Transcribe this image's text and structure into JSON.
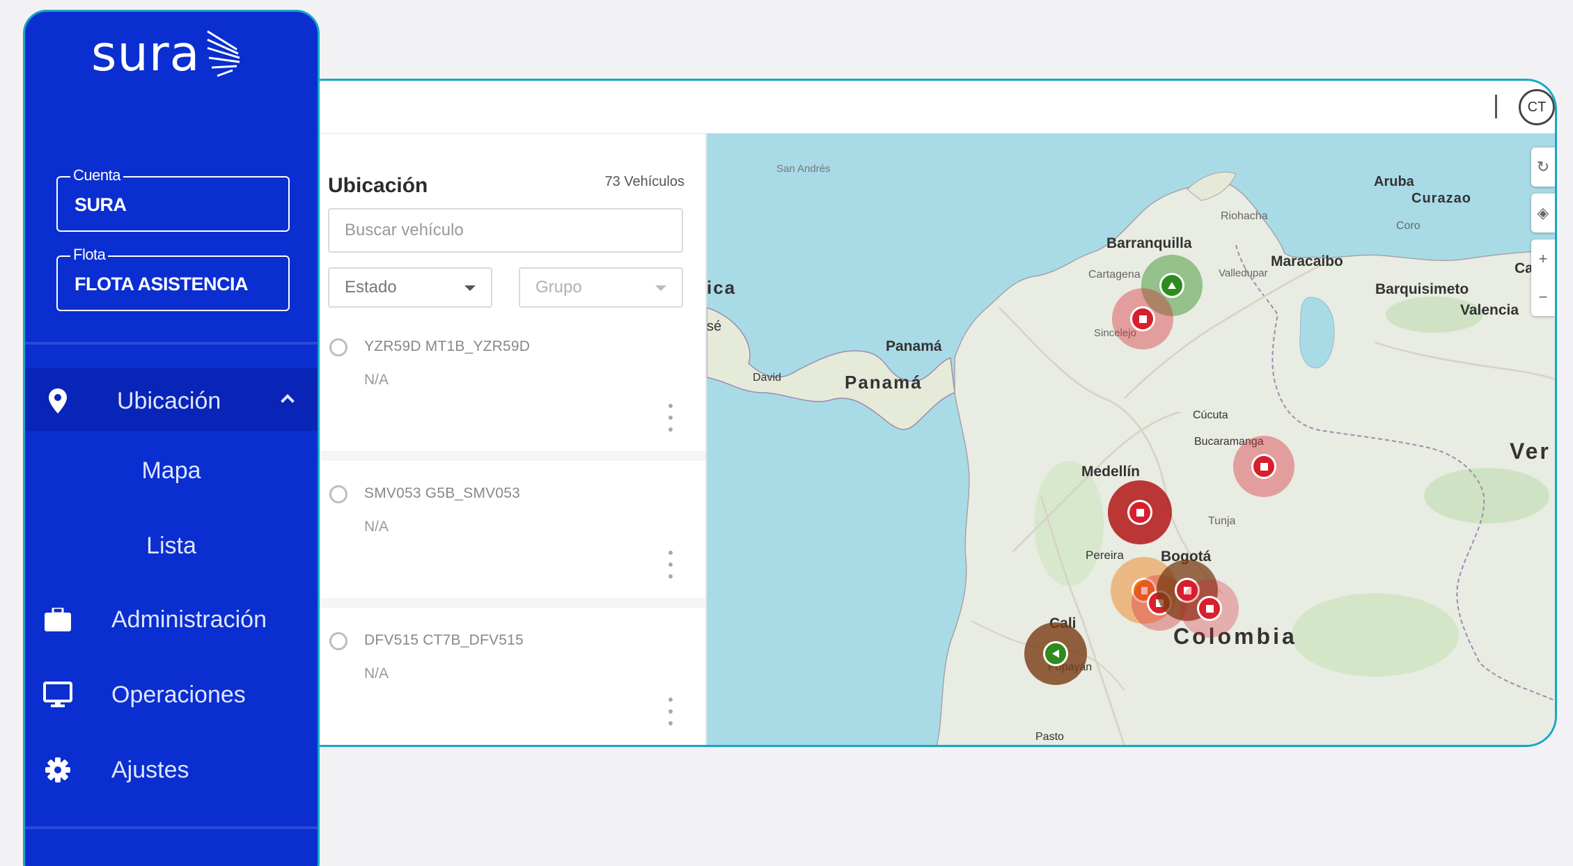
{
  "sidebar": {
    "brand": "sura",
    "account": {
      "legend": "Cuenta",
      "value": "SURA"
    },
    "fleet": {
      "legend": "Flota",
      "value": "FLOTA ASISTENCIA"
    },
    "nav": {
      "location": {
        "label": "Ubicación",
        "icon": "location-pin-icon"
      },
      "sub_map": "Mapa",
      "sub_list": "Lista",
      "admin": {
        "label": "Administración",
        "icon": "briefcase-icon"
      },
      "operations": {
        "label": "Operaciones",
        "icon": "monitor-icon"
      },
      "settings": {
        "label": "Ajustes",
        "icon": "gear-icon"
      }
    }
  },
  "topbar": {
    "avatar_initials": "CT"
  },
  "panel": {
    "title": "Ubicación",
    "count": "73 Vehículos",
    "search_placeholder": "Buscar vehículo",
    "filter_status": "Estado",
    "filter_group": "Grupo",
    "vehicles": [
      {
        "name": "YZR59D MT1B_YZR59D",
        "status": "N/A"
      },
      {
        "name": "SMV053 G5B_SMV053",
        "status": "N/A"
      },
      {
        "name": "DFV515 CT7B_DFV515",
        "status": "N/A"
      }
    ]
  },
  "map": {
    "labels": {
      "san_andres": "San Andrés",
      "aruba": "Aruba",
      "curazao": "Curazao",
      "riohacha": "Riohacha",
      "coro": "Coro",
      "barranquilla": "Barranquilla",
      "maracaibo": "Maracaibo",
      "cartagena": "Cartagena",
      "valledupar": "Valledupar",
      "barquisimeto": "Barquisimeto",
      "valencia": "Valencia",
      "ca": "Ca",
      "ica": "ica",
      "se": "sé",
      "sincelejo": "Sincelejo",
      "panama_city": "Panamá",
      "david": "David",
      "panama_country": "Panamá",
      "cucuta": "Cúcuta",
      "bucaramanga": "Bucaramanga",
      "ver": "Ver",
      "medellin": "Medellín",
      "tunja": "Tunja",
      "pereira": "Pereira",
      "bogota": "Bogotá",
      "cali": "Cali",
      "colombia": "Colombia",
      "popayan": "Popayán",
      "pasto": "Pasto"
    },
    "colors": {
      "water": "#a9dbe7",
      "land": "#e8ece2",
      "stopped": "#d71f2d",
      "moving": "#2e8b1e",
      "idle": "#ef7a12"
    }
  }
}
